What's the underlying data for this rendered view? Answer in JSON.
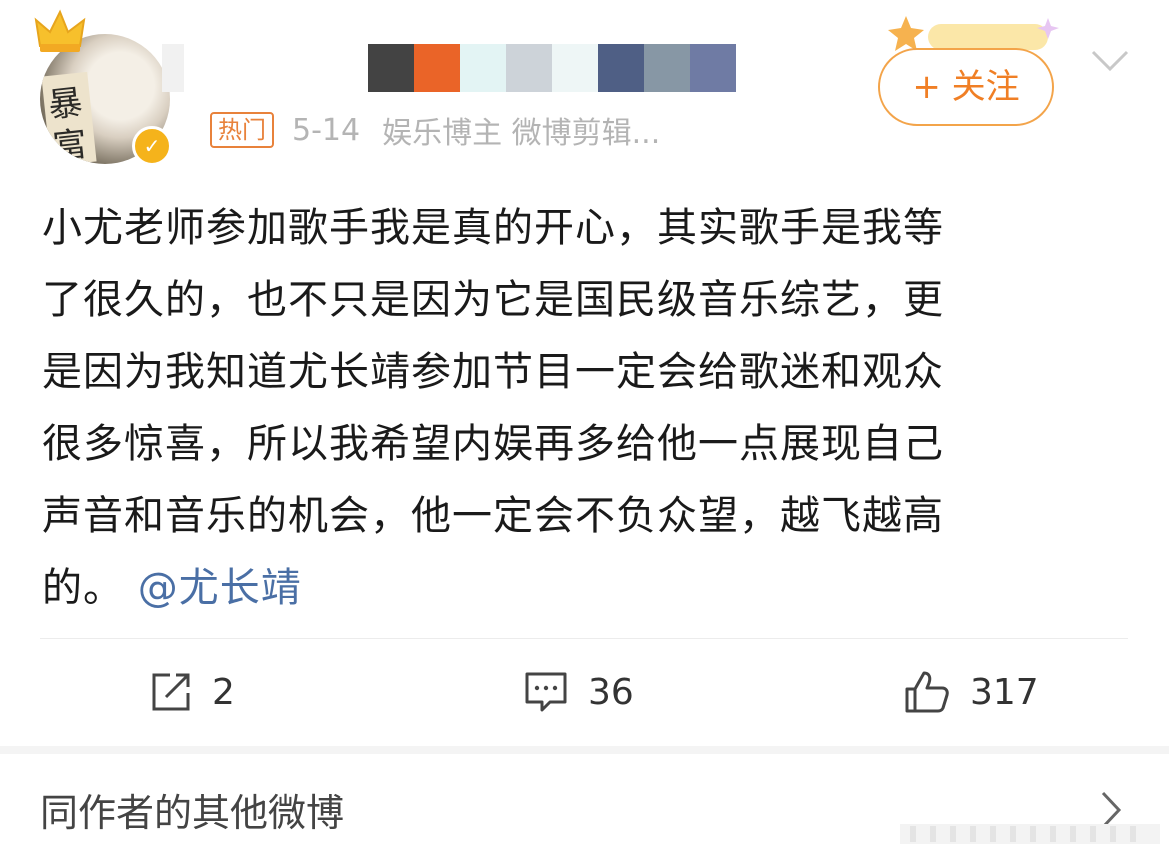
{
  "author": {
    "badge_text": "热门",
    "date": "5-14",
    "source": "娱乐博主 微博剪辑...",
    "avatar_glyphs": [
      "暴",
      "富"
    ],
    "name_mosaic_colors": [
      "#434343",
      "#ea6428",
      "#e3f4f4",
      "#cdd3d9",
      "#eef6f6",
      "#4f5f85",
      "#8797a5",
      "#6f7ba4"
    ]
  },
  "header": {
    "follow_label": "+ 关注"
  },
  "post": {
    "text_lines": [
      "小尤老师参加歌手我是真的开心，其实歌手是我等",
      "了很久的，也不只是因为它是国民级音乐综艺，更",
      "是因为我知道尤长靖参加节目一定会给歌迷和观众",
      "很多惊喜，所以我希望内娱再多给他一点展现自己",
      "声音和音乐的机会，他一定会不负众望，越飞越高"
    ],
    "last_line_prefix": "的。",
    "mention": "@尤长靖"
  },
  "actions": {
    "repost_count": "2",
    "comment_count": "36",
    "like_count": "317",
    "icons": [
      "repost-icon",
      "comment-icon",
      "like-icon"
    ]
  },
  "footer": {
    "label": "同作者的其他微博"
  },
  "colors": {
    "accent_orange": "#f07f25",
    "link_blue": "#4a6fa5",
    "meta_gray": "#b4b4b4",
    "verified_gold": "#f5b31b"
  }
}
